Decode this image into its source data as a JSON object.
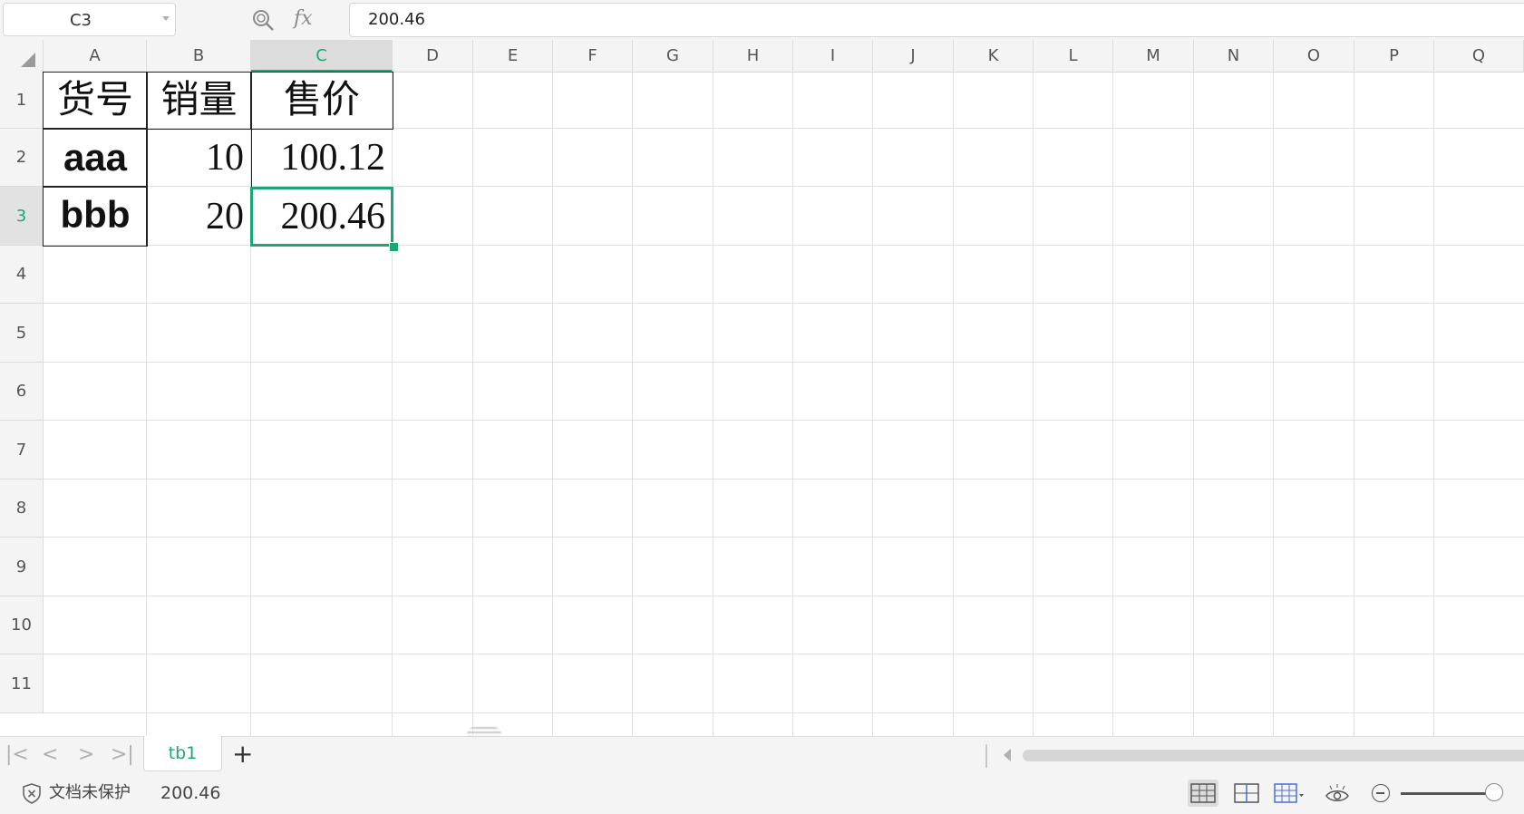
{
  "formula_bar": {
    "name_box": "C3",
    "fx_label": "fx",
    "formula_value": "200.46"
  },
  "columns": [
    "A",
    "B",
    "C",
    "D",
    "E",
    "F",
    "G",
    "H",
    "I",
    "J",
    "K",
    "L",
    "M",
    "N",
    "O",
    "P",
    "Q"
  ],
  "rows": [
    "1",
    "2",
    "3",
    "4",
    "5",
    "6",
    "7",
    "8",
    "9",
    "10",
    "11"
  ],
  "active_cell": {
    "column": "C",
    "row": "3"
  },
  "cells": {
    "A1": "货号",
    "B1": "销量",
    "C1": "售价",
    "A2": "aaa",
    "B2": "10",
    "C2": "100.12",
    "A3": "bbb",
    "B3": "20",
    "C3": "200.46"
  },
  "sheet_tabs": {
    "active": "tb1",
    "add_label": "+"
  },
  "status_bar": {
    "protection_text": "文档未保护",
    "selected_value": "200.46"
  },
  "colors": {
    "accent": "#1ea672",
    "gridline": "#e2e2e2",
    "header_bg": "#f4f4f4"
  },
  "icons": {
    "formula_bar": [
      "zoom-search-icon",
      "fx-icon"
    ],
    "sheet_nav": [
      "first-sheet-icon",
      "prev-sheet-icon",
      "next-sheet-icon",
      "last-sheet-icon"
    ],
    "status_bar": [
      "shield-icon",
      "normal-view-icon",
      "page-break-view-icon",
      "page-layout-view-icon",
      "eye-protection-icon",
      "zoom-out-icon"
    ]
  }
}
